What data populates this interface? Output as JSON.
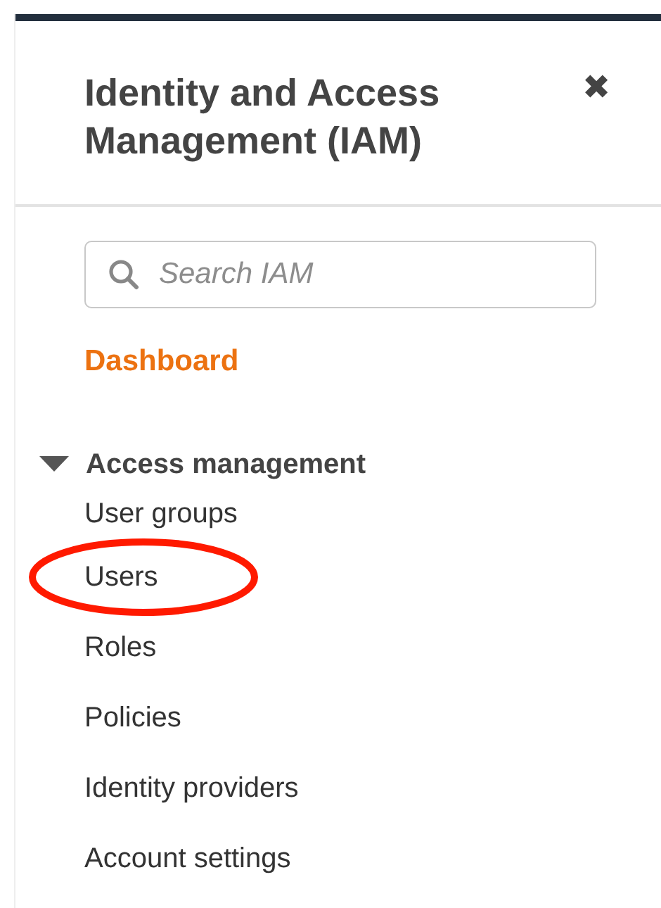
{
  "panel": {
    "title": "Identity and Access Management (IAM)",
    "close": "✖"
  },
  "search": {
    "placeholder": "Search IAM"
  },
  "dashboard": {
    "label": "Dashboard",
    "selected": true
  },
  "section": {
    "label": "Access management",
    "expanded": true,
    "items": [
      {
        "label": "User groups",
        "circled": false
      },
      {
        "label": "Users",
        "circled": true
      },
      {
        "label": "Roles",
        "circled": false
      },
      {
        "label": "Policies",
        "circled": false
      },
      {
        "label": "Identity providers",
        "circled": false
      },
      {
        "label": "Account settings",
        "circled": false
      }
    ]
  }
}
